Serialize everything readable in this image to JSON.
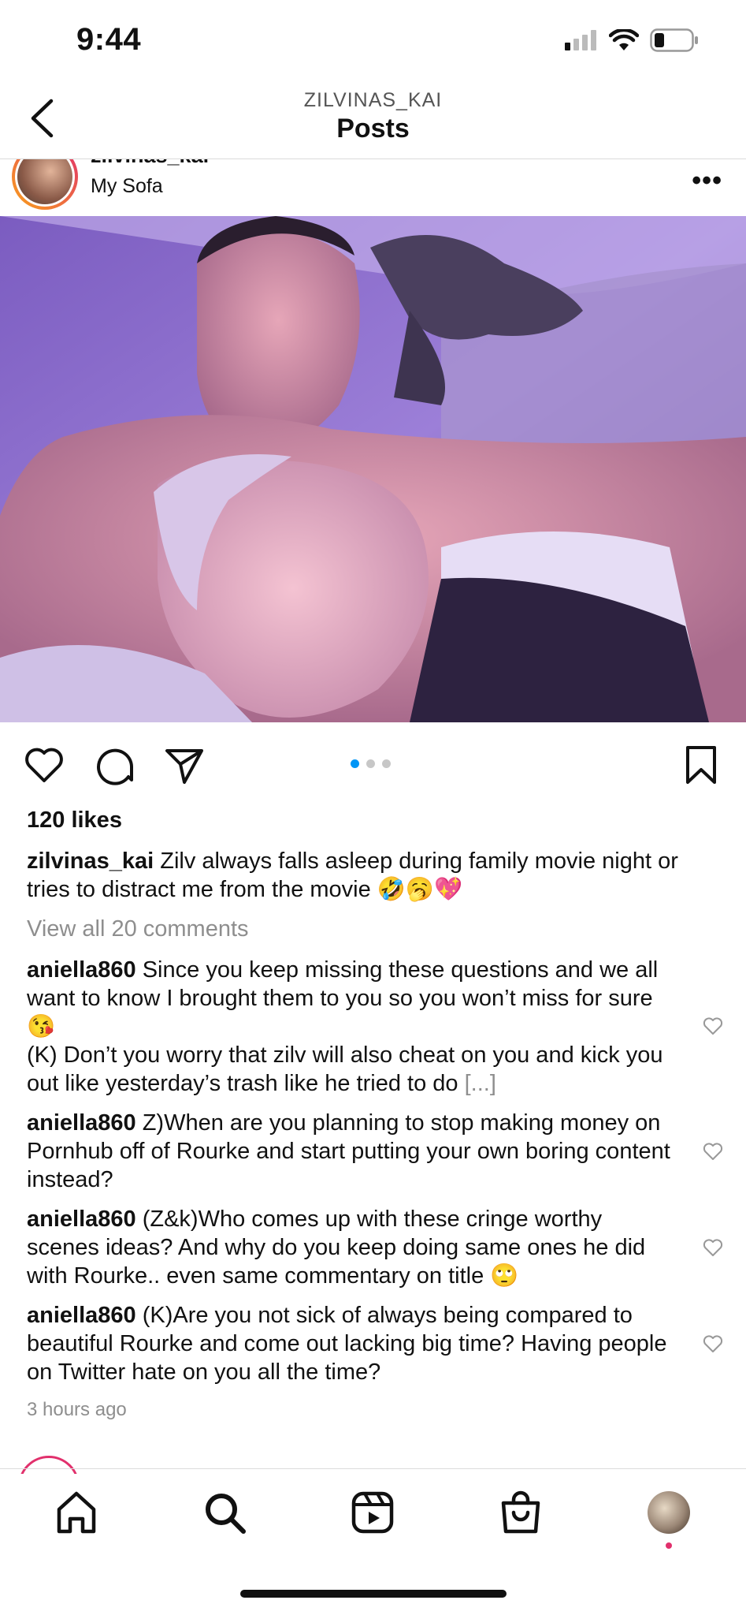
{
  "status": {
    "time": "9:44"
  },
  "header": {
    "username": "ZILVINAS_KAI",
    "title": "Posts"
  },
  "post": {
    "username": "zilvinas_kai",
    "location": "My Sofa",
    "carousel": {
      "count": 3,
      "active": 1
    },
    "likes": "120 likes",
    "caption": {
      "user": "zilvinas_kai",
      "text": " Zilv always falls asleep during family movie night or tries to distract me from the movie 🤣🥱💖"
    },
    "view_comments": "View all 20 comments",
    "comments": [
      {
        "user": "aniella860",
        "text": " Since you keep missing these questions and we all want to know I brought them to you so you won’t miss for sure 😘",
        "text2": "(K) Don’t you worry that zilv will also cheat on you and kick you out like yesterday’s trash like he tried to do ",
        "more": "[...]"
      },
      {
        "user": "aniella860",
        "text": " Z)When are you planning to stop making money on Pornhub off of Rourke and start putting your own boring content instead?"
      },
      {
        "user": "aniella860",
        "text": " (Z&k)Who comes up with these cringe worthy scenes ideas? And why do you keep doing same ones he did with Rourke.. even same commentary on title 🙄"
      },
      {
        "user": "aniella860",
        "text": " (K)Are you not sick of always being compared to beautiful Rourke and come out lacking big time? Having people on Twitter hate on you all the time?"
      }
    ],
    "timestamp": "3 hours ago"
  },
  "icons": {
    "back": "chevron-left-icon",
    "more": "more-horizontal-icon",
    "like": "heart-icon",
    "comment": "comment-bubble-icon",
    "share": "paper-plane-icon",
    "save": "bookmark-icon",
    "tabs": [
      "home-icon",
      "search-icon",
      "reels-icon",
      "shop-bag-icon",
      "profile-avatar"
    ]
  },
  "colors": {
    "accent": "#0095f6",
    "text": "#111111",
    "muted": "#8e8e8e",
    "notification": "#e1306c"
  }
}
